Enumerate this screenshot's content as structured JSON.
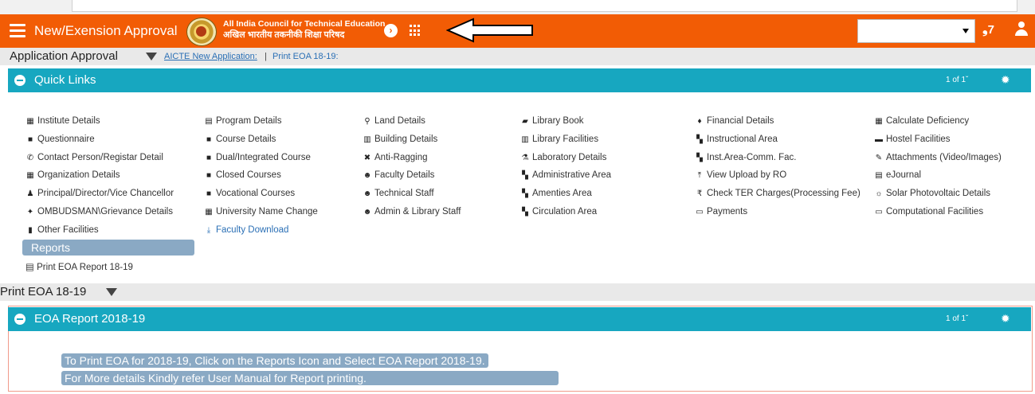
{
  "header": {
    "app_title": "New/Exension Approval",
    "org_name_en": "All India Council for Technical Education",
    "org_name_hi": "अखिल भारतीय तकनीकी शिक्षा परिषद",
    "go_icon": "chevron-circle-right-icon",
    "apps_icon": "apps-grid-icon",
    "select_value": "",
    "notification_count": "7",
    "brand_color": "#f25c05"
  },
  "subbar": {
    "title": "Application Approval",
    "breadcrumb_link": "AICTE New Application:",
    "breadcrumb_sep": "|",
    "breadcrumb_current": "Print EOA 18-19:"
  },
  "quick_links": {
    "title": "Quick Links",
    "pages": "1 of 1ˇ",
    "accent": "#17a7c0",
    "columns": [
      [
        {
          "label": "Institute Details",
          "icon": "id-card-icon",
          "glyph": "▦"
        },
        {
          "label": "Questionnaire",
          "icon": "book-icon",
          "glyph": "■"
        },
        {
          "label": "Contact Person/Registar Detail",
          "icon": "phone-icon",
          "glyph": "✆"
        },
        {
          "label": "Organization Details",
          "icon": "id-card-icon",
          "glyph": "▦"
        },
        {
          "label": "Principal/Director/Vice Chancellor",
          "icon": "person-icon",
          "glyph": "♟"
        },
        {
          "label": "OMBUDSMAN\\Grievance Details",
          "icon": "gavel-icon",
          "glyph": "✦"
        },
        {
          "label": "Other Facilities",
          "icon": "door-icon",
          "glyph": "▮"
        }
      ],
      [
        {
          "label": "Program Details",
          "icon": "list-icon",
          "glyph": "▤"
        },
        {
          "label": "Course Details",
          "icon": "book-icon",
          "glyph": "■"
        },
        {
          "label": "Dual/Integrated Course",
          "icon": "book-icon",
          "glyph": "■"
        },
        {
          "label": "Closed Courses",
          "icon": "book-icon",
          "glyph": "■"
        },
        {
          "label": "Vocational Courses",
          "icon": "book-icon",
          "glyph": "■"
        },
        {
          "label": "University Name Change",
          "icon": "id-card-icon",
          "glyph": "▦"
        },
        {
          "label": "Faculty Download",
          "icon": "download-icon",
          "glyph": "⤓",
          "link": true
        }
      ],
      [
        {
          "label": "Land Details",
          "icon": "map-marker-icon",
          "glyph": "⚲"
        },
        {
          "label": "Building Details",
          "icon": "building-icon",
          "glyph": "▥"
        },
        {
          "label": "Anti-Ragging",
          "icon": "user-times-icon",
          "glyph": "✖"
        },
        {
          "label": "Faculty Details",
          "icon": "users-icon",
          "glyph": "☻"
        },
        {
          "label": "Technical Staff",
          "icon": "users-icon",
          "glyph": "☻"
        },
        {
          "label": "Admin & Library Staff",
          "icon": "users-icon",
          "glyph": "☻"
        }
      ],
      [
        {
          "label": "Library Book",
          "icon": "book-icon",
          "glyph": "▰"
        },
        {
          "label": "Library Facilities",
          "icon": "library-icon",
          "glyph": "▥"
        },
        {
          "label": "Laboratory Details",
          "icon": "flask-icon",
          "glyph": "⚗"
        },
        {
          "label": "Administrative Area",
          "icon": "map-icon",
          "glyph": "▚"
        },
        {
          "label": "Amenties Area",
          "icon": "map-icon",
          "glyph": "▚"
        },
        {
          "label": "Circulation Area",
          "icon": "map-icon",
          "glyph": "▚"
        }
      ],
      [
        {
          "label": "Financial Details",
          "icon": "money-bag-icon",
          "glyph": "♦"
        },
        {
          "label": "Instructional Area",
          "icon": "map-icon",
          "glyph": "▚"
        },
        {
          "label": "Inst.Area-Comm. Fac.",
          "icon": "map-icon",
          "glyph": "▚"
        },
        {
          "label": "View Upload by RO",
          "icon": "upload-icon",
          "glyph": "⤒"
        },
        {
          "label": "Check TER Charges(Processing Fee)",
          "icon": "rupee-icon",
          "glyph": "₹"
        },
        {
          "label": "Payments",
          "icon": "credit-card-icon",
          "glyph": "▭"
        }
      ],
      [
        {
          "label": "Calculate Deficiency",
          "icon": "calculator-icon",
          "glyph": "▦"
        },
        {
          "label": "Hostel Facilities",
          "icon": "bed-icon",
          "glyph": "▬"
        },
        {
          "label": "Attachments (Video/Images)",
          "icon": "paperclip-icon",
          "glyph": "✎"
        },
        {
          "label": "eJournal",
          "icon": "file-icon",
          "glyph": "▤"
        },
        {
          "label": "Solar Photovoltaic Details",
          "icon": "sun-icon",
          "glyph": "☼"
        },
        {
          "label": "Computational Facilities",
          "icon": "desktop-icon",
          "glyph": "▭"
        }
      ]
    ],
    "reports_label": "Reports",
    "print_report_label": "Print EOA Report 18-19"
  },
  "print_section": {
    "title": "Print EOA 18-19"
  },
  "eoa_report": {
    "title": "EOA Report 2018-19",
    "pages": "1 of 1ˇ",
    "messages": [
      "To Print EOA for 2018-19, Click on the Reports Icon and Select EOA Report 2018-19.",
      "For More details Kindly refer User Manual for Report printing."
    ]
  }
}
